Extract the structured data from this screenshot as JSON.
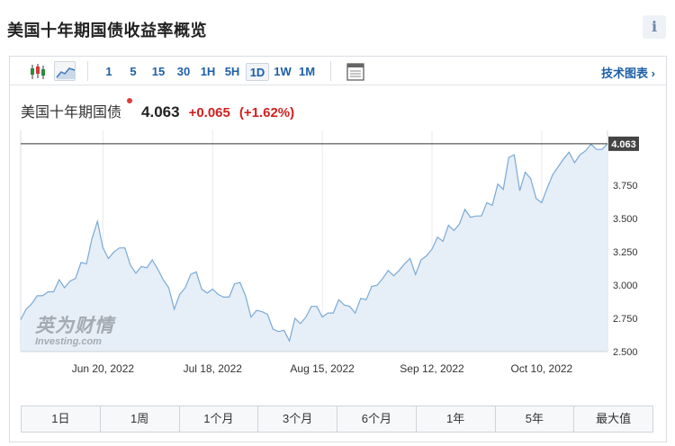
{
  "page": {
    "title": "美国十年期国债收益率概览",
    "info_label": "i"
  },
  "toolbar": {
    "intervals": [
      "1",
      "5",
      "15",
      "30",
      "1H",
      "5H",
      "1D",
      "1W",
      "1M"
    ],
    "active_interval": "1D",
    "tech_link": "技术图表 ›"
  },
  "quote": {
    "name": "美国十年期国债",
    "price": "4.063",
    "change": "+0.065",
    "change_pct": "(+1.62%)",
    "up_color": "#d21f1f"
  },
  "watermark": {
    "cn": "英为财情",
    "en": "Investing.com"
  },
  "ranges": [
    "1日",
    "1周",
    "1个月",
    "3个月",
    "6个月",
    "1年",
    "5年",
    "最大值"
  ],
  "chart_data": {
    "type": "area",
    "ylim": [
      2.5,
      4.15
    ],
    "yticks": [
      2.5,
      2.75,
      3.0,
      3.25,
      3.5,
      3.75
    ],
    "ytick_labels": [
      "2.500",
      "2.750",
      "3.000",
      "3.250",
      "3.500",
      "3.750"
    ],
    "xtick_labels": [
      "Jun 20, 2022",
      "Jul 18, 2022",
      "Aug 15, 2022",
      "Sep 12, 2022",
      "Oct 10, 2022"
    ],
    "xtick_index": [
      15,
      35,
      55,
      75,
      95
    ],
    "last_value_label": "4.063",
    "last_value": 4.063,
    "fill_color": "#e6eef7",
    "line_color": "#7aaad6",
    "values": [
      2.74,
      2.82,
      2.86,
      2.92,
      2.92,
      2.95,
      2.95,
      3.04,
      2.98,
      3.03,
      3.05,
      3.17,
      3.16,
      3.35,
      3.48,
      3.28,
      3.2,
      3.25,
      3.28,
      3.28,
      3.15,
      3.09,
      3.14,
      3.13,
      3.19,
      3.12,
      3.04,
      2.98,
      2.82,
      2.93,
      2.98,
      3.08,
      3.1,
      2.97,
      2.94,
      2.97,
      2.93,
      2.91,
      2.91,
      3.01,
      3.02,
      2.92,
      2.76,
      2.81,
      2.8,
      2.78,
      2.67,
      2.65,
      2.66,
      2.58,
      2.75,
      2.71,
      2.76,
      2.84,
      2.84,
      2.76,
      2.79,
      2.79,
      2.89,
      2.85,
      2.84,
      2.79,
      2.9,
      2.89,
      2.99,
      3.0,
      3.05,
      3.11,
      3.07,
      3.11,
      3.16,
      3.2,
      3.08,
      3.19,
      3.22,
      3.27,
      3.36,
      3.33,
      3.45,
      3.41,
      3.46,
      3.57,
      3.51,
      3.52,
      3.52,
      3.62,
      3.6,
      3.76,
      3.72,
      3.96,
      3.98,
      3.71,
      3.85,
      3.8,
      3.65,
      3.62,
      3.73,
      3.83,
      3.89,
      3.95,
      4.0,
      3.92,
      3.98,
      4.01,
      4.06,
      4.02,
      4.02,
      4.063
    ]
  }
}
